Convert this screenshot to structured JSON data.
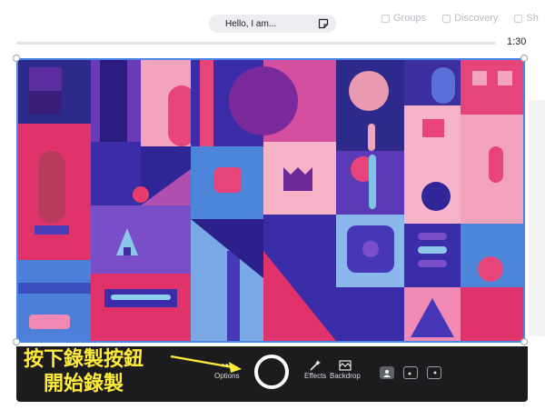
{
  "background_nav": {
    "groups_label": "Groups",
    "discovery_label": "Discovery",
    "partial_label": "Sh"
  },
  "note_pill": {
    "text": "Hello, I am..."
  },
  "timeline": {
    "progress": 0.0,
    "time": "1:30"
  },
  "controls": {
    "options_label": "Options",
    "effects_label": "Effects",
    "backdrop_label": "Backdrop"
  },
  "annotation": {
    "line1": "按下錄製按鈕",
    "line2": "開始錄製"
  },
  "colors": {
    "frame_border": "#4a86e8",
    "control_bar": "#1c1c1f",
    "annotation": "#ffeb3b"
  }
}
